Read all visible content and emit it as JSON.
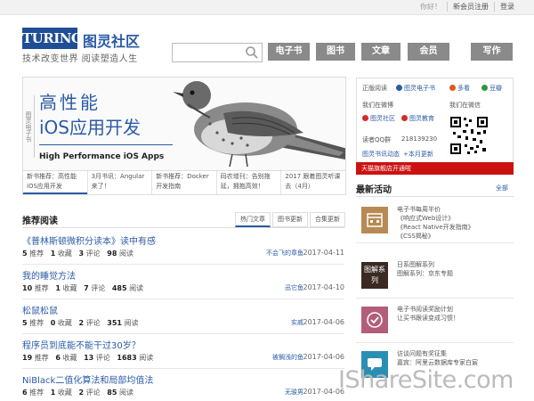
{
  "topbar": {
    "greeting": "你好！",
    "register": "新会员注册",
    "login": "登录"
  },
  "header": {
    "logo": "TURING",
    "logo_cn": "图灵社区",
    "slogan": "技术改变世界  阅读塑造人生",
    "search_placeholder": ""
  },
  "nav": [
    "电子书",
    "图书",
    "文章",
    "会员",
    "写作"
  ],
  "banner": {
    "side": "图灵电子书",
    "title1": "高性能",
    "title2": "iOS应用开发",
    "subtitle": "High Performance iOS Apps"
  },
  "banner_tabs": [
    "新书推荐：高性能iOS应用开发",
    "3月书讯：Angular来了！",
    "新书推荐：Docker开发指南",
    "码农增刊：告别拖延，拥抱高效！",
    "2017 跟着图灵听课去（4月）"
  ],
  "recommended": {
    "title": "推荐阅读",
    "tabs": [
      "热门文章",
      "图书更新",
      "合集更新"
    ],
    "rows": [
      {
        "title": "《普林斯顿微积分读本》读中有感",
        "rec": "5",
        "rec_l": "推荐",
        "fav": "1",
        "fav_l": "收藏",
        "com": "3",
        "com_l": "评论",
        "read": "98",
        "read_l": "阅读",
        "author": "不会飞的章鱼",
        "date": "2017-04-11"
      },
      {
        "title": "我的睡觉方法",
        "rec": "10",
        "rec_l": "推荐",
        "fav": "1",
        "fav_l": "收藏",
        "com": "7",
        "com_l": "评论",
        "read": "485",
        "read_l": "阅读",
        "author": "迅它鱼",
        "date": "2017-04-10"
      },
      {
        "title": "松鼠松鼠",
        "rec": "5",
        "rec_l": "推荐",
        "fav": "0",
        "fav_l": "收藏",
        "com": "2",
        "com_l": "评论",
        "read": "351",
        "read_l": "阅读",
        "author": "实戚",
        "date": "2017-04-06"
      },
      {
        "title": "程序员到底能不能干过30岁？",
        "rec": "19",
        "rec_l": "推荐",
        "fav": "6",
        "fav_l": "收藏",
        "com": "13",
        "com_l": "评论",
        "read": "1683",
        "read_l": "阅读",
        "author": "被搁浅的鱼",
        "date": "2017-04-06"
      },
      {
        "title": "NiBlack二值化算法和局部均值法",
        "rec": "6",
        "rec_l": "推荐",
        "fav": "1",
        "fav_l": "收藏",
        "com": "2",
        "com_l": "评论",
        "read": "85",
        "read_l": "阅读",
        "author": "无骏男",
        "date": "2017-04-06"
      }
    ]
  },
  "right": {
    "row1": [
      "正版阅读",
      "图灵电子书",
      "多看",
      "豆瓣"
    ],
    "weibo_label": "我们在微博",
    "wechat_label": "我们在微信",
    "weibo1": "图灵社区",
    "weibo2": "图灵教育",
    "qq_label": "读者QQ群",
    "qq_num": "218139230",
    "news_label": "图灵书讯动态",
    "more": "+本月更新",
    "redbar": "天猫旗舰店开通啦",
    "latest_title": "最新活动",
    "latest_all": "全部",
    "acts": [
      {
        "l1": "电子书每周半价",
        "l2": "《响应式Web设计》",
        "l3": "《React Native开发指南》",
        "thumb": "《CSS揭秘》",
        "thumb_color": "#b68a52"
      },
      {
        "l1": "日系图解系列",
        "l2": "图解系列：京东专题",
        "l3": "",
        "thumb": "图解系列",
        "thumb_color": "#3a2a22"
      },
      {
        "l1": "电子书阅读奖励计划",
        "l2": "让买书跟读变成习惯！",
        "l3": "",
        "thumb": "",
        "thumb_color": "#b25e7a"
      },
      {
        "l1": "访谈问题有奖征集",
        "l2": "嘉宾：阿里云数据库专家白宸",
        "l3": "",
        "thumb": "",
        "thumb_color": "#2a8fb2"
      }
    ]
  },
  "watermark": "IShareSite.com"
}
